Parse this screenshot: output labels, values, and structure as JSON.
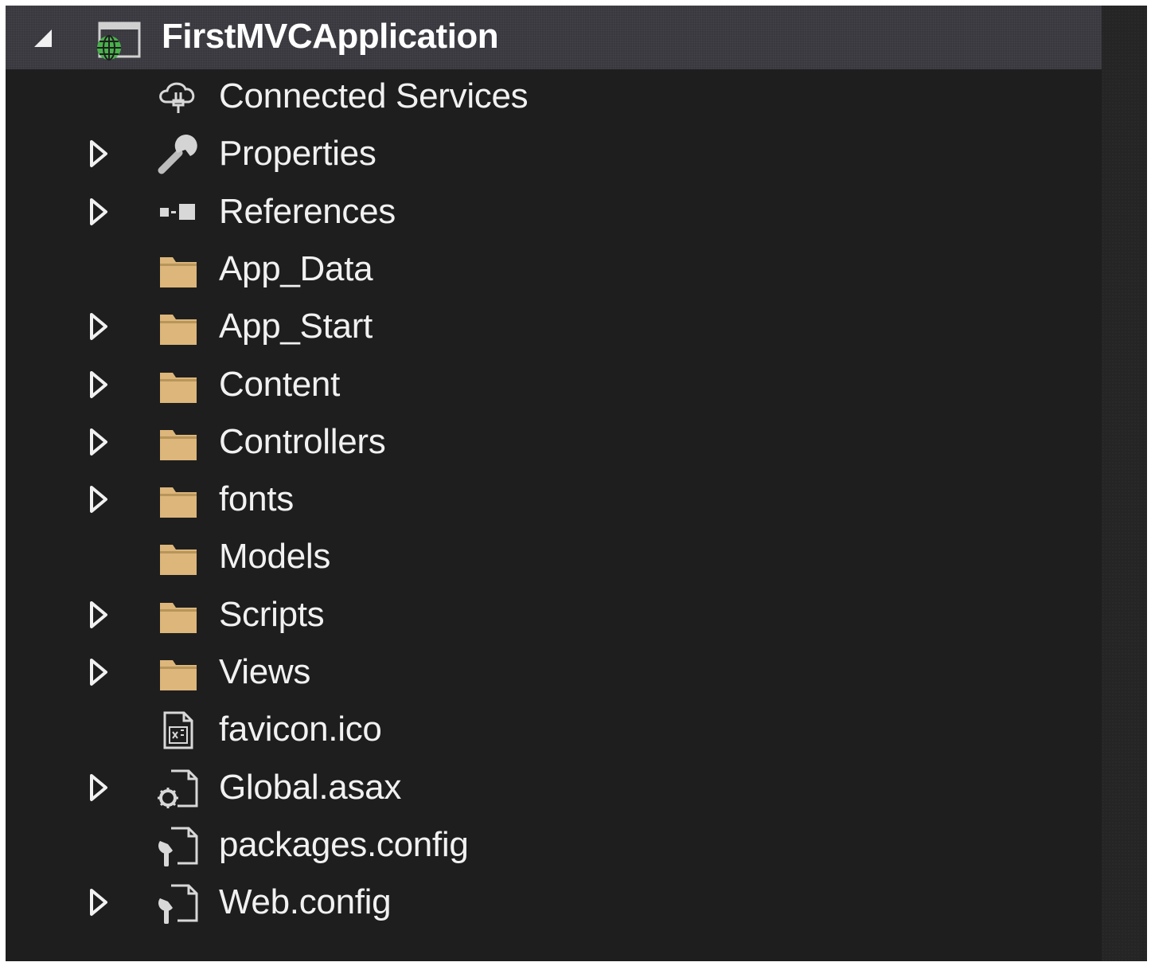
{
  "project": {
    "name": "FirstMVCApplication",
    "expanded": true,
    "icon": "web-project-icon"
  },
  "colors": {
    "panel_background": "#1e1e1e",
    "header_background": "#38383e",
    "text": "#f1f1f1",
    "folder": "#dcb67a",
    "globe": "#49b14c"
  },
  "items": [
    {
      "label": "Connected Services",
      "icon": "cloud-plug-icon",
      "expandable": false
    },
    {
      "label": "Properties",
      "icon": "wrench-icon",
      "expandable": true
    },
    {
      "label": "References",
      "icon": "references-icon",
      "expandable": true
    },
    {
      "label": "App_Data",
      "icon": "folder-icon",
      "expandable": false
    },
    {
      "label": "App_Start",
      "icon": "folder-icon",
      "expandable": true
    },
    {
      "label": "Content",
      "icon": "folder-icon",
      "expandable": true
    },
    {
      "label": "Controllers",
      "icon": "folder-icon",
      "expandable": true
    },
    {
      "label": "fonts",
      "icon": "folder-icon",
      "expandable": true
    },
    {
      "label": "Models",
      "icon": "folder-icon",
      "expandable": false
    },
    {
      "label": "Scripts",
      "icon": "folder-icon",
      "expandable": true
    },
    {
      "label": "Views",
      "icon": "folder-icon",
      "expandable": true
    },
    {
      "label": "favicon.ico",
      "icon": "icon-file-icon",
      "expandable": false
    },
    {
      "label": "Global.asax",
      "icon": "gear-file-icon",
      "expandable": true
    },
    {
      "label": "packages.config",
      "icon": "config-file-icon",
      "expandable": false
    },
    {
      "label": "Web.config",
      "icon": "config-file-icon",
      "expandable": true
    }
  ]
}
